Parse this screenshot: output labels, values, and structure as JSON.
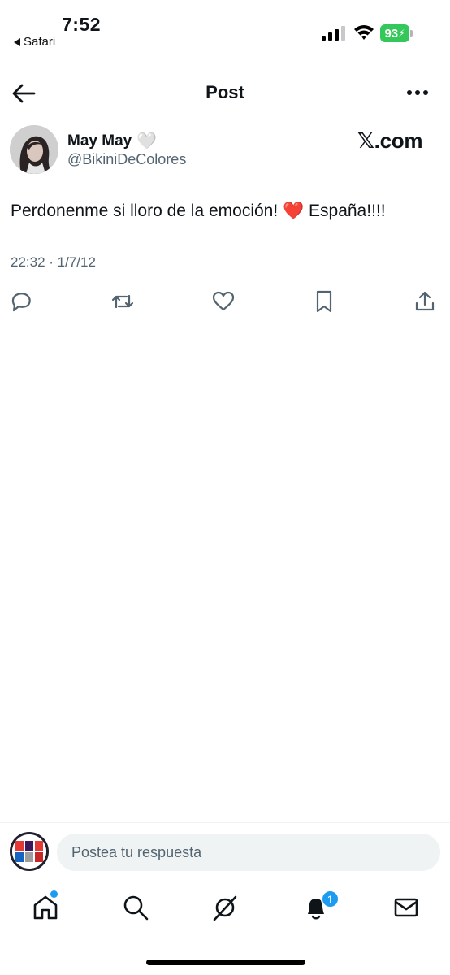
{
  "status_bar": {
    "time": "7:52",
    "back_app": "Safari",
    "battery": "93",
    "battery_color": "#34c759"
  },
  "header": {
    "title": "Post",
    "back_icon": "arrow-left-icon",
    "more_icon": "more-horizontal-icon"
  },
  "tweet": {
    "display_name": "May May",
    "name_emoji": "🤍",
    "handle": "@BikiniDeColores",
    "source_label": "𝕏.com",
    "text": "Perdonenme si lloro de la emoción! ",
    "text_emoji": "❤️",
    "text_tail": " España!!!!",
    "timestamp": "22:32 · 1/7/12"
  },
  "actions": [
    {
      "name": "reply",
      "icon": "reply-icon"
    },
    {
      "name": "repost",
      "icon": "repost-icon"
    },
    {
      "name": "like",
      "icon": "heart-icon"
    },
    {
      "name": "bookmark",
      "icon": "bookmark-icon"
    },
    {
      "name": "share",
      "icon": "share-icon"
    }
  ],
  "reply_bar": {
    "placeholder": "Postea tu respuesta"
  },
  "bottom_nav": {
    "items": [
      "home",
      "search",
      "grok",
      "notifications",
      "messages"
    ],
    "notifications_count": "1",
    "accent_color": "#1d9bf0"
  }
}
